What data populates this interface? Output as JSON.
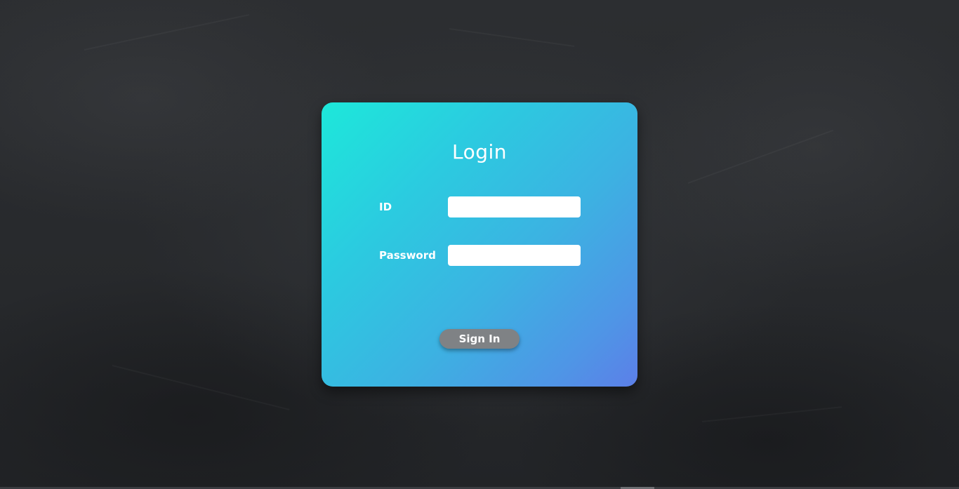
{
  "login": {
    "title": "Login",
    "id_label": "ID",
    "id_value": "",
    "password_label": "Password",
    "password_value": "",
    "signin_label": "Sign In"
  },
  "colors": {
    "background": "#2a2c2f",
    "card_gradient_start": "#1de8da",
    "card_gradient_end": "#5c7fe8",
    "button": "#7f8285",
    "text": "#ffffff"
  }
}
